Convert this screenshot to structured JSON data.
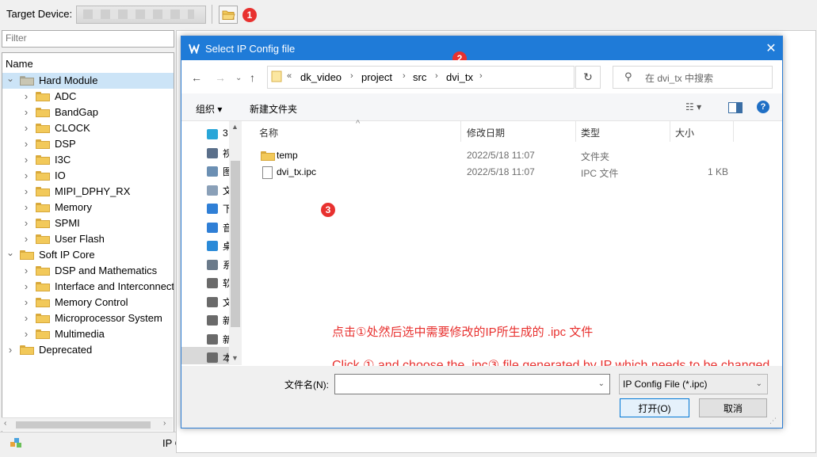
{
  "top_bar": {
    "target_label": "Target Device:",
    "badge_1": "1"
  },
  "left_pane": {
    "filter_placeholder": "Filter",
    "tree_header": "Name",
    "items": [
      {
        "label": "Hard Module",
        "level": 0,
        "expanded": true,
        "selected": true,
        "folder": "grey"
      },
      {
        "label": "ADC",
        "level": 1
      },
      {
        "label": "BandGap",
        "level": 1
      },
      {
        "label": "CLOCK",
        "level": 1
      },
      {
        "label": "DSP",
        "level": 1
      },
      {
        "label": "I3C",
        "level": 1
      },
      {
        "label": "IO",
        "level": 1
      },
      {
        "label": "MIPI_DPHY_RX",
        "level": 1
      },
      {
        "label": "Memory",
        "level": 1
      },
      {
        "label": "SPMI",
        "level": 1
      },
      {
        "label": "User Flash",
        "level": 1
      },
      {
        "label": "Soft IP Core",
        "level": 0,
        "expanded": true
      },
      {
        "label": "DSP and Mathematics",
        "level": 1
      },
      {
        "label": "Interface and Interconnect",
        "level": 1
      },
      {
        "label": "Memory Control",
        "level": 1
      },
      {
        "label": "Microprocessor System",
        "level": 1
      },
      {
        "label": "Multimedia",
        "level": 1
      },
      {
        "label": "Deprecated",
        "level": 0,
        "expanded": false
      }
    ]
  },
  "bottom_tab": {
    "label": "IP Core Generator",
    "close": "✕"
  },
  "dialog": {
    "title": "Select IP Config file",
    "close": "✕",
    "badge_2": "2",
    "breadcrumb": {
      "lead": "«",
      "parts": [
        "dk_video",
        "project",
        "src",
        "dvi_tx"
      ]
    },
    "search_placeholder": "在 dvi_tx 中搜索",
    "toolbar": {
      "organize": "组织 ▾",
      "new_folder": "新建文件夹",
      "view": "☷ ▾",
      "help": "?"
    },
    "nav_items": [
      {
        "text": "3",
        "color": "#29a6d8"
      },
      {
        "text": "视",
        "color": "#5a6f8a"
      },
      {
        "text": "图",
        "color": "#6b8fb3"
      },
      {
        "text": "文",
        "color": "#8aa0b8"
      },
      {
        "text": "下",
        "color": "#2f7fd6"
      },
      {
        "text": "音",
        "color": "#2f7fd6"
      },
      {
        "text": "桌",
        "color": "#2a8ad8"
      },
      {
        "text": "系",
        "color": "#6a7a8a"
      },
      {
        "text": "软",
        "color": "#6a6a6a"
      },
      {
        "text": "文",
        "color": "#6a6a6a"
      },
      {
        "text": "新",
        "color": "#6a6a6a"
      },
      {
        "text": "新",
        "color": "#6a6a6a"
      },
      {
        "text": "本",
        "color": "#6a6a6a"
      }
    ],
    "columns": [
      "名称",
      "修改日期",
      "类型",
      "大小"
    ],
    "files": [
      {
        "name": "temp",
        "date": "2022/5/18 11:07",
        "type": "文件夹",
        "size": "",
        "kind": "folder"
      },
      {
        "name": "dvi_tx.ipc",
        "date": "2022/5/18 11:07",
        "type": "IPC 文件",
        "size": "1 KB",
        "kind": "file"
      }
    ],
    "badge_3": "3",
    "annotation_cn": "点击①处然后选中需要修改的IP所生成的 .ipc 文件",
    "annotation_en": "Click ① and choose the .ipc③ file generated by IP which needs to be changed",
    "filename_label": "文件名(N):",
    "filename_value": "",
    "filetype": "IP Config File (*.ipc)",
    "open_button": "打开(O)",
    "cancel_button": "取消"
  },
  "colors": {
    "titlebar": "#1f7bd8",
    "badge": "#e8312f",
    "annotation": "#e8312f",
    "selection": "#cce4f7"
  }
}
